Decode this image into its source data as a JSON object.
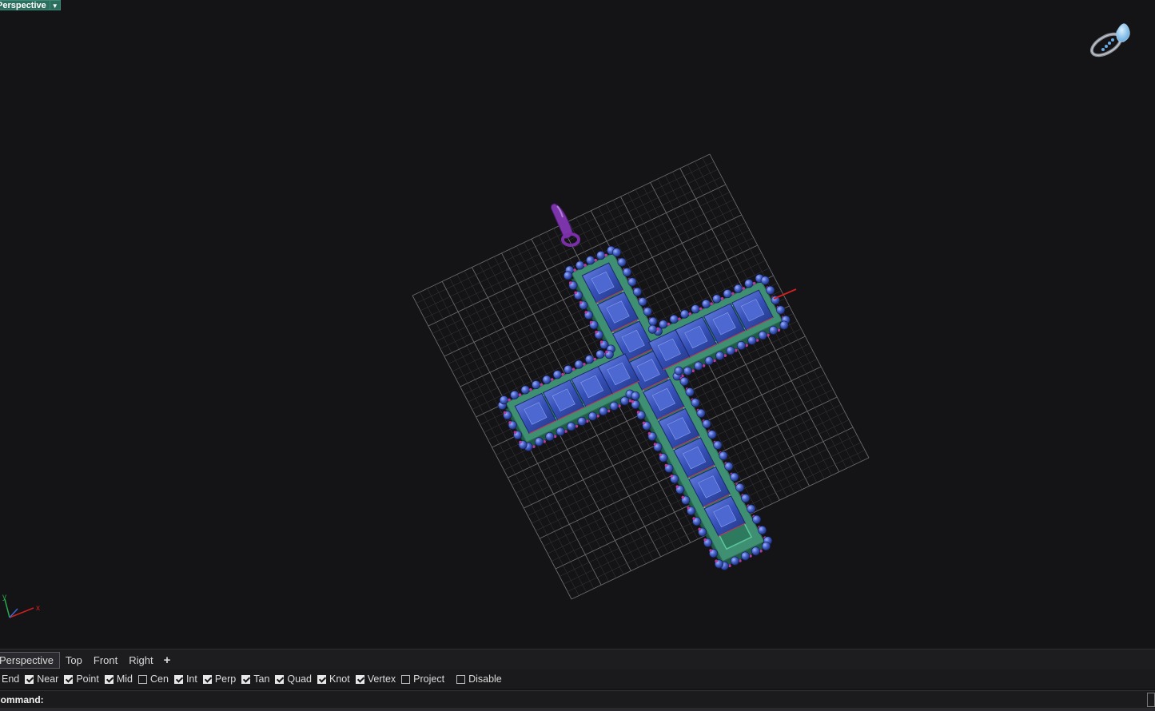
{
  "viewport": {
    "title": "Perspective",
    "dropdown_icon": "triangle-down",
    "colors": {
      "background": "#141416",
      "grid": "#5e5e62",
      "metal": "#3f8f72",
      "gem": "#3854b8",
      "bead": "#4a63c8",
      "bail": "#7a2fa8",
      "x_axis": "#d12020",
      "y_axis": "#2aa84a"
    },
    "axis_labels": {
      "x": "x",
      "y": "y"
    }
  },
  "tabs": [
    {
      "label": "Perspective",
      "active": true
    },
    {
      "label": "Top",
      "active": false
    },
    {
      "label": "Front",
      "active": false
    },
    {
      "label": "Right",
      "active": false
    },
    {
      "label": "+",
      "active": false
    }
  ],
  "osnaps": [
    {
      "label": "End",
      "checked": false,
      "show_box": false
    },
    {
      "label": "Near",
      "checked": true,
      "show_box": true
    },
    {
      "label": "Point",
      "checked": true,
      "show_box": true
    },
    {
      "label": "Mid",
      "checked": true,
      "show_box": true
    },
    {
      "label": "Cen",
      "checked": false,
      "show_box": true
    },
    {
      "label": "Int",
      "checked": true,
      "show_box": true
    },
    {
      "label": "Perp",
      "checked": true,
      "show_box": true
    },
    {
      "label": "Tan",
      "checked": true,
      "show_box": true
    },
    {
      "label": "Quad",
      "checked": true,
      "show_box": true
    },
    {
      "label": "Knot",
      "checked": true,
      "show_box": true
    },
    {
      "label": "Vertex",
      "checked": true,
      "show_box": true
    },
    {
      "label": "Project",
      "checked": false,
      "show_box": true
    },
    {
      "label": "Disable",
      "checked": false,
      "show_box": true
    }
  ],
  "command": {
    "label": "Command:",
    "value": ""
  }
}
